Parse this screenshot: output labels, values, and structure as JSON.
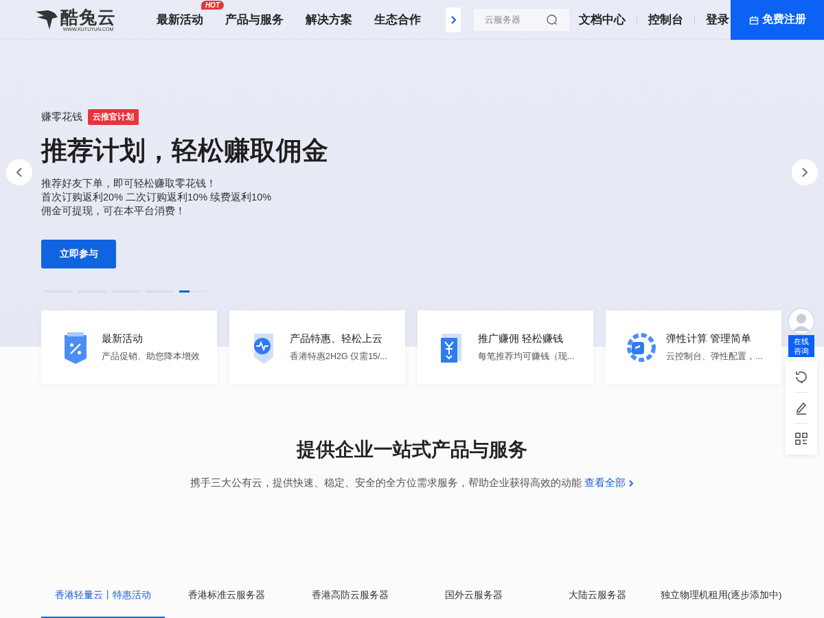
{
  "header": {
    "logo": {
      "name": "酷兔云",
      "domain": "WWW.KUTUYUN.COM"
    },
    "nav": [
      {
        "label": "最新活动",
        "badge": "HOT"
      },
      {
        "label": "产品与服务"
      },
      {
        "label": "解决方案"
      },
      {
        "label": "生态合作"
      }
    ],
    "search": {
      "placeholder": "云服务器"
    },
    "links": [
      "文档中心",
      "控制台",
      "登录"
    ],
    "register": "免费注册"
  },
  "hero": {
    "eyebrow": "赚零花钱",
    "tag": "云推官计划",
    "title": "推荐计划，轻松赚取佣金",
    "lines": [
      "推荐好友下单，即可轻松赚取零花钱！",
      "首次订购返利20% 二次订购返利10% 续费返利10%",
      "佣金可提现，可在本平台消费！"
    ],
    "button": "立即参与",
    "slides": [
      {
        "selected": false
      },
      {
        "selected": false
      },
      {
        "selected": false
      },
      {
        "selected": false
      },
      {
        "selected": true
      }
    ]
  },
  "features": [
    {
      "kind": "percent",
      "title": "最新活动",
      "desc": "产品促销、助您降本增效"
    },
    {
      "kind": "pulse",
      "title": "产品特惠、轻松上云",
      "desc": "香港特惠2H2G 仅需15/..."
    },
    {
      "kind": "yen",
      "title": "推广赚佣 轻松赚钱",
      "desc": "每笔推荐均可赚钱（现..."
    },
    {
      "kind": "gear",
      "title": "弹性计算 管理简单",
      "desc": "云控制台、弹性配置，..."
    }
  ],
  "float_panel": {
    "consult": "在线咨询"
  },
  "section": {
    "title": "提供企业一站式产品与服务",
    "subtitle": "携手三大公有云，提供快速、稳定、安全的全方位需求服务，帮助企业获得高效的动能",
    "link": "查看全部"
  },
  "tabs": [
    {
      "label": "香港轻量云丨特惠活动",
      "selected": true
    },
    {
      "label": "香港标准云服务器",
      "selected": false
    },
    {
      "label": "香港高防云服务器",
      "selected": false
    },
    {
      "label": "国外云服务器",
      "selected": false
    },
    {
      "label": "大陆云服务器",
      "selected": false
    },
    {
      "label": "独立物理机租用(逐步添加中)",
      "selected": false
    }
  ]
}
